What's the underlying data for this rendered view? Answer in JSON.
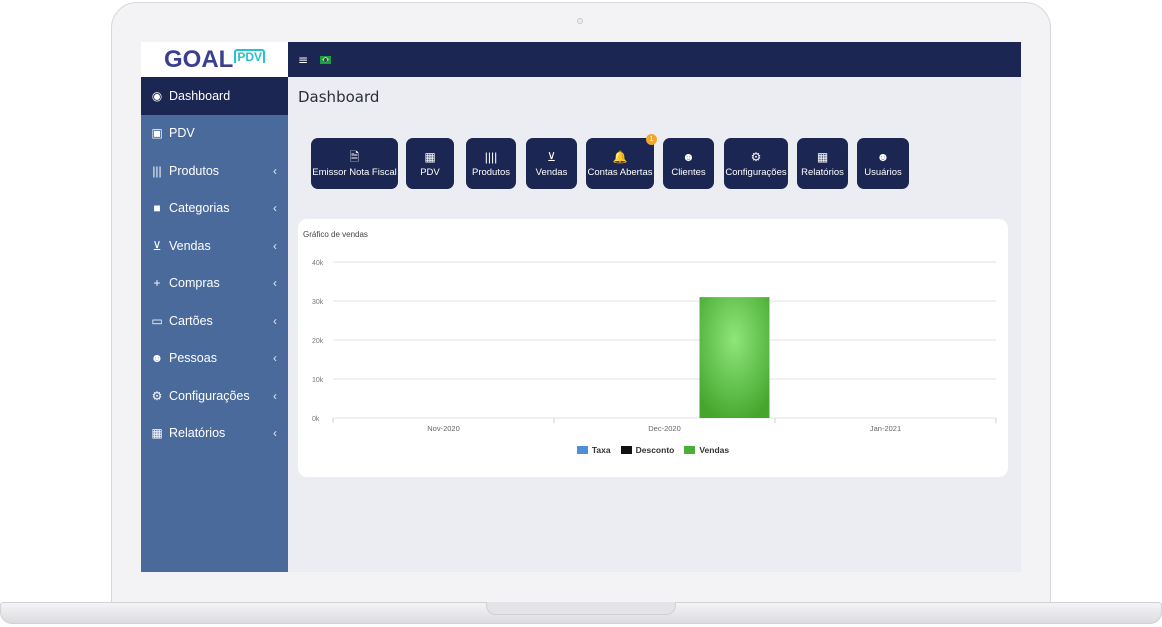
{
  "brand": {
    "main": "GOAL",
    "sub": "PDV"
  },
  "sidebar": {
    "items": [
      {
        "label": "Dashboard",
        "icon": "dashboard-icon",
        "glyph": "◉",
        "caret": "",
        "active": true
      },
      {
        "label": "PDV",
        "icon": "money-icon",
        "glyph": "▣",
        "caret": ""
      },
      {
        "label": "Produtos",
        "icon": "barcode-icon",
        "glyph": "|||",
        "caret": "‹"
      },
      {
        "label": "Categorias",
        "icon": "folder-icon",
        "glyph": "■",
        "caret": "‹"
      },
      {
        "label": "Vendas",
        "icon": "cart-icon",
        "glyph": "⊻",
        "caret": "‹"
      },
      {
        "label": "Compras",
        "icon": "plus-icon",
        "glyph": "+",
        "caret": "‹"
      },
      {
        "label": "Cartões",
        "icon": "credit-card-icon",
        "glyph": "▭",
        "caret": "‹"
      },
      {
        "label": "Pessoas",
        "icon": "users-icon",
        "glyph": "☻",
        "caret": "‹"
      },
      {
        "label": "Configurações",
        "icon": "gears-icon",
        "glyph": "⚙",
        "caret": "‹"
      },
      {
        "label": "Relatórios",
        "icon": "bar-chart-icon",
        "glyph": "▦",
        "caret": "‹"
      }
    ]
  },
  "topbar": {
    "menu_glyph": "≡"
  },
  "page": {
    "title": "Dashboard"
  },
  "quick_actions": [
    {
      "label": "Emissor Nota Fiscal",
      "glyph": "🗎",
      "icon": "document-icon"
    },
    {
      "label": "PDV",
      "glyph": "▦",
      "icon": "grid-icon"
    },
    {
      "label": "Produtos",
      "glyph": "||||",
      "icon": "barcode-icon"
    },
    {
      "label": "Vendas",
      "glyph": "⊻",
      "icon": "cart-icon"
    },
    {
      "label": "Contas Abertas",
      "glyph": "🔔",
      "icon": "bell-icon",
      "badge": "1"
    },
    {
      "label": "Clientes",
      "glyph": "☻",
      "icon": "users-icon"
    },
    {
      "label": "Configurações",
      "glyph": "⚙",
      "icon": "gears-icon"
    },
    {
      "label": "Relatórios",
      "glyph": "▦",
      "icon": "bar-chart-icon"
    },
    {
      "label": "Usuários",
      "glyph": "☻",
      "icon": "users-icon"
    }
  ],
  "chart_data": {
    "type": "bar",
    "title": "Gráfico de vendas",
    "categories": [
      "Nov-2020",
      "Dec-2020",
      "Jan-2021"
    ],
    "series": [
      {
        "name": "Taxa",
        "color": "#4f8fd6",
        "values": [
          0,
          0,
          0
        ]
      },
      {
        "name": "Desconto",
        "color": "#111111",
        "values": [
          0,
          0,
          0
        ]
      },
      {
        "name": "Vendas",
        "color": "#4caf35",
        "values": [
          0,
          31000,
          0
        ]
      }
    ],
    "ylim": [
      0,
      40000
    ],
    "yticks": [
      "0k",
      "10k",
      "20k",
      "30k",
      "40k"
    ],
    "legend": "bottom",
    "grid": true
  }
}
